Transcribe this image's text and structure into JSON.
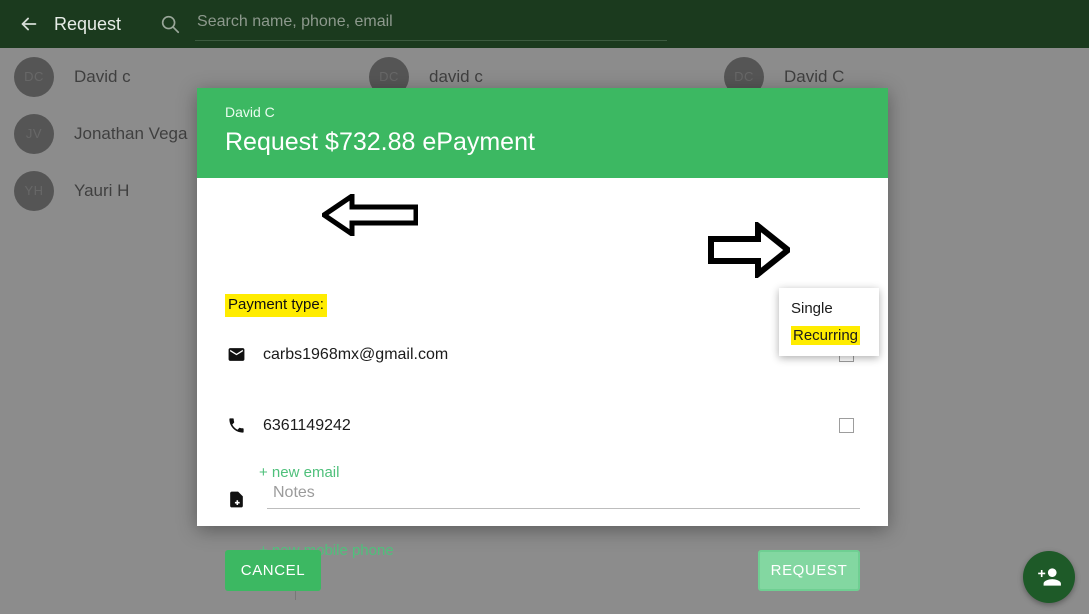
{
  "appbar": {
    "back_icon": "back-arrow-icon",
    "title": "Request",
    "search_icon": "search-icon",
    "search_value": "",
    "search_placeholder": "Search name, phone, email"
  },
  "contacts": {
    "columns": [
      {
        "items": [
          {
            "initials": "DC",
            "name": "David c"
          },
          {
            "initials": "JV",
            "name": "Jonathan Vega"
          },
          {
            "initials": "YH",
            "name": "Yauri H"
          }
        ]
      },
      {
        "items": [
          {
            "initials": "DC",
            "name": "david c"
          }
        ]
      },
      {
        "items": [
          {
            "initials": "DC",
            "name": "David C"
          }
        ]
      }
    ]
  },
  "fab": {
    "icon": "add-person-icon"
  },
  "dialog": {
    "contact_name": "David C",
    "title": "Request $732.88 ePayment",
    "payment_type_label": "Payment type:",
    "email": {
      "icon": "envelope-icon",
      "value": "carbs1968mx@gmail.com",
      "add_link": "+ new email",
      "checked": false
    },
    "phone": {
      "icon": "phone-icon",
      "value": "6361149242",
      "add_link": "+ new mobile phone",
      "checked": false
    },
    "notes": {
      "icon": "note-add-icon",
      "value": "",
      "placeholder": "Notes"
    },
    "cancel_label": "CANCEL",
    "request_label": "REQUEST"
  },
  "dropdown": {
    "options": [
      "Single",
      "Recurring"
    ],
    "highlighted": "Recurring"
  },
  "annotations": {
    "left_arrow": "left-arrow-annotation",
    "right_arrow": "right-arrow-annotation"
  },
  "colors": {
    "appbar": "#1b3a1e",
    "brand_green": "#3cb862",
    "link_green": "#4fc07b",
    "disabled_green": "#83d7a1",
    "highlight_yellow": "#ffec00",
    "scrim": "#555555"
  }
}
